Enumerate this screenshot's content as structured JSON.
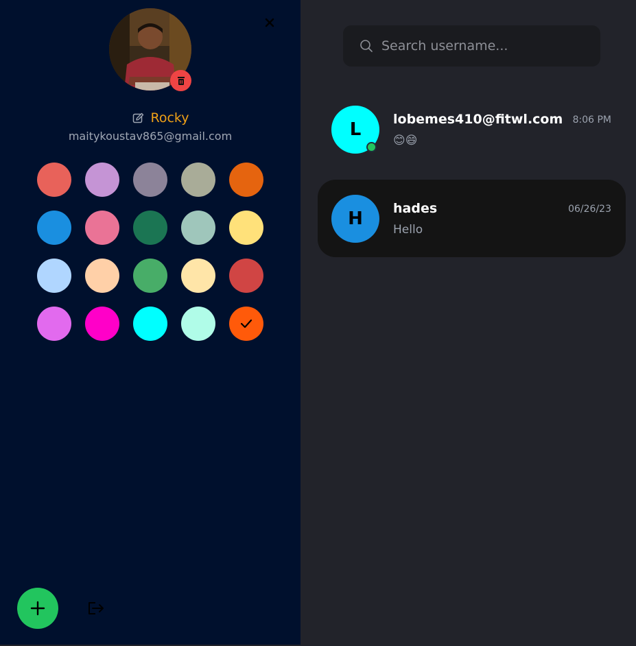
{
  "profile": {
    "name": "Rocky",
    "email": "maitykoustav865@gmail.com"
  },
  "color_palette": [
    "#e8625a",
    "#c594d5",
    "#8c8399",
    "#a9ac98",
    "#e5640f",
    "#1a8fe0",
    "#ea7396",
    "#1b7553",
    "#9fc6bb",
    "#ffe17a",
    "#b0d6ff",
    "#ffd0a8",
    "#48ad68",
    "#ffe5a8",
    "#d04544",
    "#e26aee",
    "#ff00c8",
    "#00ffff",
    "#b0fce8",
    "#ff5a0a"
  ],
  "selected_color": "#ff5a0a",
  "search": {
    "placeholder": "Search username..."
  },
  "chats": [
    {
      "avatar_letter": "L",
      "avatar_color": "#00ffff",
      "name": "lobemes410@fitwl.com",
      "time": "8:06 PM",
      "message": "😊😄",
      "online": true,
      "active": false
    },
    {
      "avatar_letter": "H",
      "avatar_color": "#1a8fe0",
      "name": "hades",
      "time": "06/26/23",
      "message": "Hello",
      "online": false,
      "active": true
    }
  ]
}
